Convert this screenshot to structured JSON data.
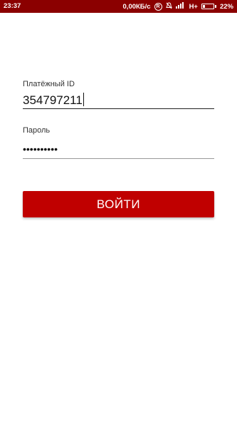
{
  "status_bar": {
    "time": "23:37",
    "net_speed": "0,00КБ/с",
    "r_badge": "R",
    "signal_text": "H+",
    "battery_percent": "22%",
    "battery_level": 0.22,
    "background_color": "#8b0000"
  },
  "login_form": {
    "id_label": "Платёжный ID",
    "id_value": "354797211",
    "password_label": "Пароль",
    "password_value": "••••••••••",
    "submit_label": "ВОЙТИ",
    "accent_color": "#c00000"
  }
}
